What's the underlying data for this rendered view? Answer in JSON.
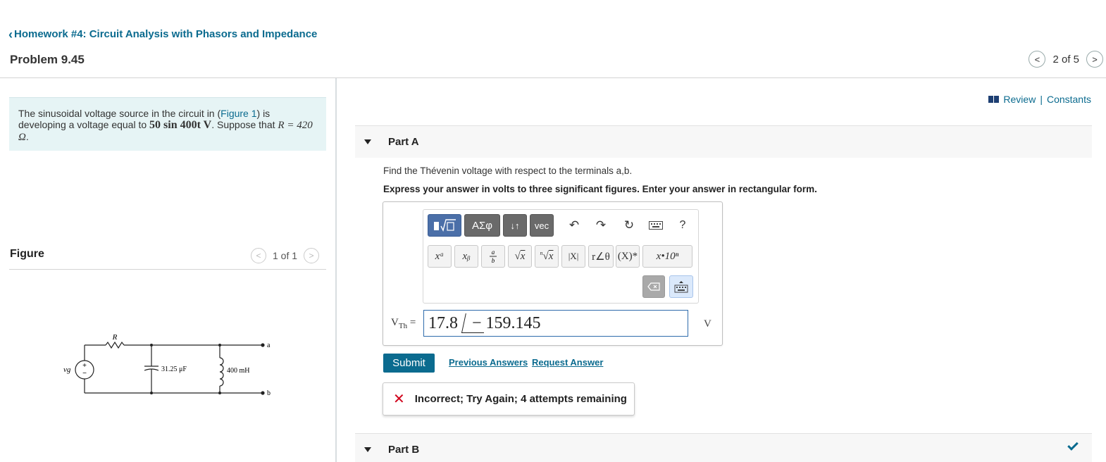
{
  "header": {
    "back_link": "Homework #4: Circuit Analysis with Phasors and Impedance",
    "problem_title": "Problem 9.45",
    "pager": "2 of 5"
  },
  "problem": {
    "text_1": "The sinusoidal voltage source in the circuit in (",
    "figure_link": "Figure 1",
    "text_2": ") is developing a voltage equal to ",
    "voltage_expr": "50 sin 400t V",
    "text_3": ". Suppose that ",
    "resistance": "R = 420 Ω",
    "text_4": "."
  },
  "figure": {
    "label": "Figure",
    "pager": "1 of 1",
    "circuit": {
      "source_label": "vg",
      "resistor_label": "R",
      "capacitor_label": "31.25 μF",
      "inductor_label": "400 mH",
      "terminal_a": "a",
      "terminal_b": "b"
    }
  },
  "links": {
    "review": "Review",
    "separator": "|",
    "constants": "Constants"
  },
  "part_a": {
    "title": "Part A",
    "question": "Find the Thévenin voltage with respect to the terminals a,b.",
    "instruction": "Express your answer in volts to three significant figures. Enter your answer in rectangular form.",
    "toolbar": {
      "greek": "ΑΣφ",
      "arrows": "↓↑",
      "vec": "vec",
      "help": "?",
      "xa": "xᵃ",
      "xb": "xᵦ",
      "abs": "|X|",
      "polar": "r∠θ",
      "conj": "(X)*",
      "sci": "x•10ⁿ"
    },
    "answer_label": "V",
    "answer_sub": "Th",
    "answer_equals": "=",
    "answer_magnitude": "17.8",
    "answer_angle": "− 159.145",
    "unit": "V",
    "submit": "Submit",
    "previous_answers": "Previous Answers",
    "request_answer": "Request Answer",
    "feedback": "Incorrect; Try Again; 4 attempts remaining"
  },
  "part_b": {
    "title": "Part B"
  }
}
